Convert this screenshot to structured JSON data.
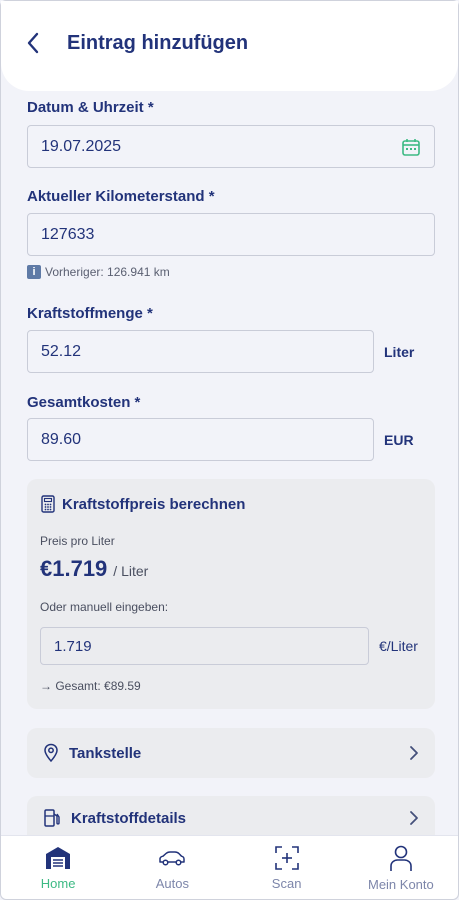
{
  "header": {
    "title": "Eintrag hinzufügen"
  },
  "form": {
    "date": {
      "label": "Datum & Uhrzeit *",
      "value": "19.07.2025"
    },
    "odometer": {
      "label": "Aktueller Kilometerstand *",
      "value": "127633",
      "hint": "Vorheriger: 126.941 km"
    },
    "fuel": {
      "label": "Kraftstoffmenge *",
      "value": "52.12",
      "unit": "Liter"
    },
    "cost": {
      "label": "Gesamtkosten *",
      "value": "89.60",
      "unit": "EUR"
    }
  },
  "calculator": {
    "title": "Kraftstoffpreis berechnen",
    "price_label": "Preis pro Liter",
    "price_value": "€1.719",
    "price_unit": "/ Liter",
    "manual_label": "Oder manuell eingeben:",
    "manual_value": "1.719",
    "manual_unit": "€/Liter",
    "total": "→ Gesamt: €89.59"
  },
  "sections": {
    "station": "Tankstelle",
    "fuel_details": "Kraftstoffdetails"
  },
  "bottom_nav": {
    "home": "Home",
    "cars": "Autos",
    "scan": "Scan",
    "account": "Mein Konto"
  },
  "colors": {
    "accent": "#3dba84",
    "primary": "#22337a",
    "muted": "#7d86aa"
  }
}
